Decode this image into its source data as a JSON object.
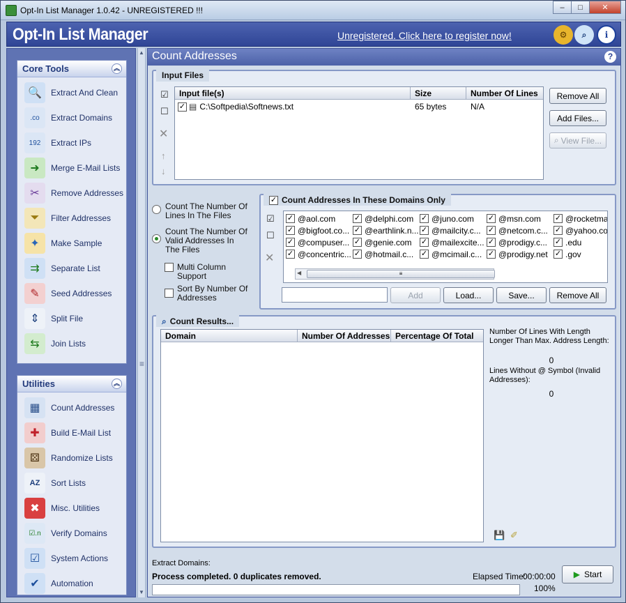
{
  "window": {
    "title": "Opt-In List Manager 1.0.42 - UNREGISTERED !!!",
    "buttons": [
      "–",
      "□",
      "✕"
    ]
  },
  "header": {
    "app_name": "Opt-In List Manager",
    "register_link": "Unregistered. Click here to register now!"
  },
  "sidebar": {
    "core_tools": {
      "title": "Core Tools",
      "items": [
        {
          "label": "Extract And Clean",
          "icon": "magnifier-globe-icon"
        },
        {
          "label": "Extract Domains",
          "icon": "magnifier-com-icon"
        },
        {
          "label": "Extract IPs",
          "icon": "magnifier-ip-icon"
        },
        {
          "label": "Merge E-Mail Lists",
          "icon": "merge-lists-icon"
        },
        {
          "label": "Remove Addresses",
          "icon": "remove-addresses-icon"
        },
        {
          "label": "Filter Addresses",
          "icon": "funnel-icon"
        },
        {
          "label": "Make Sample",
          "icon": "sample-puzzle-icon"
        },
        {
          "label": "Separate List",
          "icon": "separate-list-icon"
        },
        {
          "label": "Seed Addresses",
          "icon": "syringe-icon"
        },
        {
          "label": "Split File",
          "icon": "split-file-icon"
        },
        {
          "label": "Join Lists",
          "icon": "join-lists-icon"
        }
      ]
    },
    "utilities": {
      "title": "Utilities",
      "items": [
        {
          "label": "Count Addresses",
          "icon": "calculator-icon"
        },
        {
          "label": "Build E-Mail List",
          "icon": "swiss-knife-icon"
        },
        {
          "label": "Randomize Lists",
          "icon": "dice-icon"
        },
        {
          "label": "Sort Lists",
          "icon": "sort-az-icon"
        },
        {
          "label": "Misc. Utilities",
          "icon": "toolbox-icon"
        },
        {
          "label": "Verify Domains",
          "icon": "verify-domains-icon"
        },
        {
          "label": "System Actions",
          "icon": "checklist-icon"
        },
        {
          "label": "Automation",
          "icon": "automation-icon"
        }
      ]
    }
  },
  "main": {
    "title": "Count Addresses",
    "input_files": {
      "label": "Input Files",
      "columns": [
        "Input file(s)",
        "Size",
        "Number Of Lines"
      ],
      "rows": [
        {
          "file": "C:\\Softpedia\\Softnews.txt",
          "size": "65 bytes",
          "lines": "N/A"
        }
      ],
      "buttons": {
        "remove_all": "Remove All",
        "add_files": "Add Files...",
        "view_file": "View File..."
      }
    },
    "count_options": {
      "option1": "Count The Number Of Lines In The Files",
      "option2": "Count The Number Of Valid Addresses In The Files",
      "multi_column": "Multi Column Support",
      "sort_by_number": "Sort By Number Of Addresses"
    },
    "domains": {
      "label": "Count Addresses In These Domains Only",
      "grid": [
        [
          "@aol.com",
          "@delphi.com",
          "@juno.com",
          "@msn.com",
          "@rocketma"
        ],
        [
          "@bigfoot.co...",
          "@earthlink.n...",
          "@mailcity.c...",
          "@netcom.c...",
          "@yahoo.co"
        ],
        [
          "@compuser...",
          "@genie.com",
          "@mailexcite...",
          "@prodigy.c...",
          ".edu"
        ],
        [
          "@concentric...",
          "@hotmail.c...",
          "@mcimail.c...",
          "@prodigy.net",
          ".gov"
        ]
      ],
      "input_value": "",
      "buttons": {
        "add": "Add",
        "load": "Load...",
        "save": "Save...",
        "remove_all": "Remove All"
      }
    },
    "results": {
      "label": "Count Results...",
      "columns": [
        "Domain",
        "Number Of Addresses",
        "Percentage Of Total"
      ],
      "max_length_label": "Number Of Lines With Length Longer Than Max. Address Length:",
      "max_length_value": "0",
      "no_at_label": "Lines Without @ Symbol (Invalid Addresses):",
      "no_at_value": "0"
    },
    "status": {
      "operation": "Extract Domains:",
      "message": "Process completed. 0 duplicates removed.",
      "elapsed_label": "Elapsed Time:",
      "elapsed_value": "00:00:00",
      "progress_text": "100%",
      "progress": 1.0,
      "start_label": "Start"
    }
  }
}
